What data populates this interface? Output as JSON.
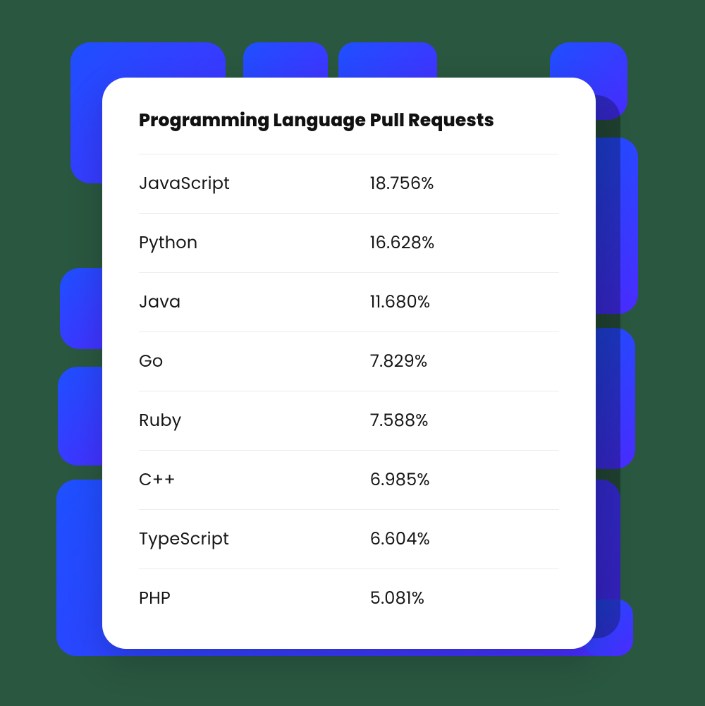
{
  "chart_data": {
    "type": "table",
    "columns": [
      "Programming Language",
      "Pull Requests"
    ],
    "rows": [
      {
        "language": "JavaScript",
        "pull_requests": "18.756%"
      },
      {
        "language": "Python",
        "pull_requests": "16.628%"
      },
      {
        "language": "Java",
        "pull_requests": "11.680%"
      },
      {
        "language": "Go",
        "pull_requests": "7.829%"
      },
      {
        "language": "Ruby",
        "pull_requests": "7.588%"
      },
      {
        "language": "C++",
        "pull_requests": "6.985%"
      },
      {
        "language": "TypeScript",
        "pull_requests": "6.604%"
      },
      {
        "language": "PHP",
        "pull_requests": "5.081%"
      }
    ]
  }
}
